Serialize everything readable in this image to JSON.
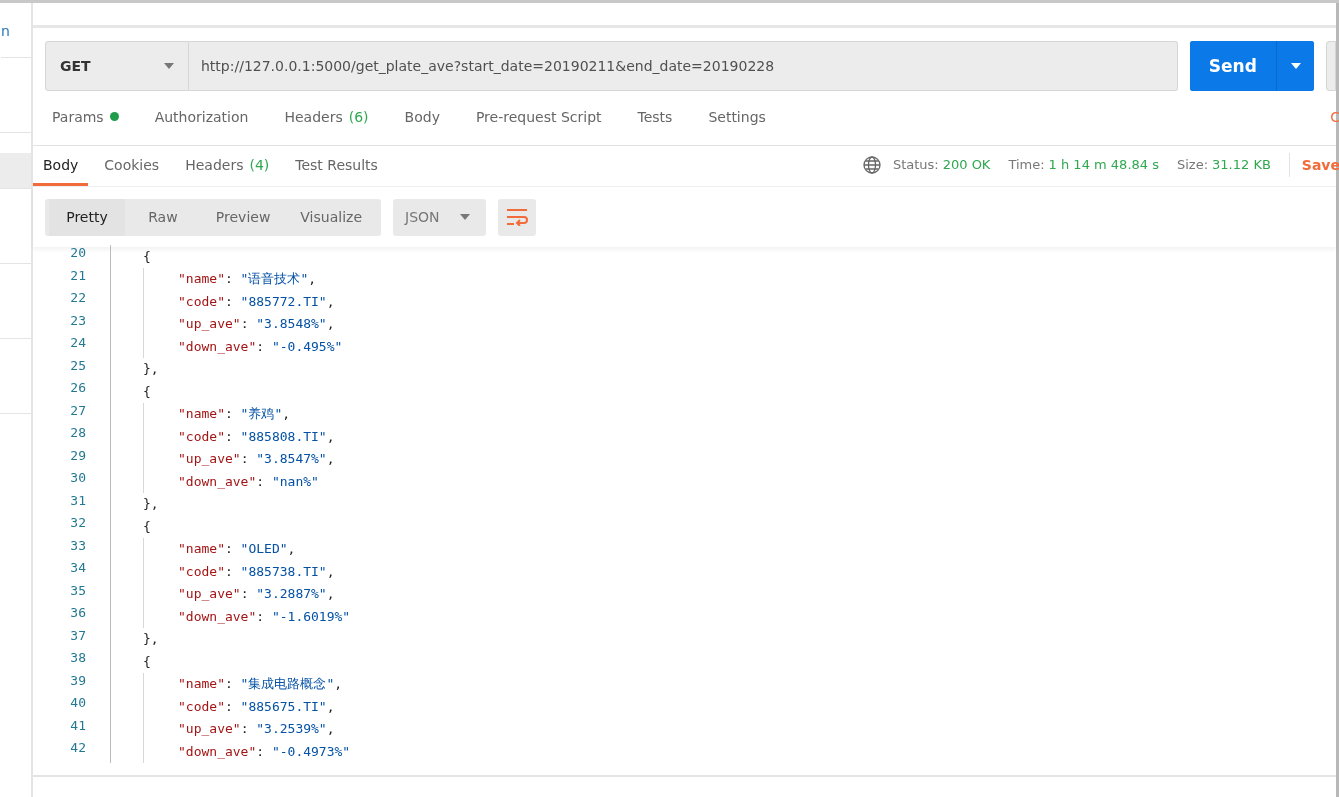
{
  "sidebar": {
    "cut_text": "n",
    "items": [
      {
        "selected": false
      },
      {
        "selected": true
      },
      {
        "selected": false
      },
      {
        "selected": false
      },
      {
        "selected": false
      }
    ]
  },
  "request": {
    "method": "GET",
    "url": "http://127.0.0.1:5000/get_plate_ave?start_date=20190211&end_date=20190228",
    "send": "Send"
  },
  "request_tabs": [
    {
      "label": "Params",
      "dot": true,
      "selected": false
    },
    {
      "label": "Authorization",
      "dot": false,
      "selected": false
    },
    {
      "label": "Headers",
      "count": "(6)",
      "dot": false,
      "selected": false
    },
    {
      "label": "Body",
      "dot": false,
      "selected": false
    },
    {
      "label": "Pre-request Script",
      "dot": false,
      "selected": false
    },
    {
      "label": "Tests",
      "dot": false,
      "selected": false
    },
    {
      "label": "Settings",
      "dot": false,
      "selected": false
    }
  ],
  "request_tabs_cut_link": "C",
  "response_tabs": [
    {
      "label": "Body",
      "selected": true
    },
    {
      "label": "Cookies",
      "selected": false
    },
    {
      "label": "Headers",
      "count": "(4)",
      "selected": false
    },
    {
      "label": "Test Results",
      "selected": false
    }
  ],
  "response_meta": [
    {
      "label": "Status:",
      "value": "200 OK"
    },
    {
      "label": "Time:",
      "value": "1 h 14 m 48.84 s"
    },
    {
      "label": "Size:",
      "value": "31.12 KB"
    }
  ],
  "save": "Save",
  "view_modes": [
    {
      "label": "Pretty",
      "selected": true
    },
    {
      "label": "Raw",
      "selected": false
    },
    {
      "label": "Preview",
      "selected": false
    },
    {
      "label": "Visualize",
      "selected": false
    }
  ],
  "format": "JSON",
  "code_lines": [
    {
      "num": "20",
      "kind": "brace",
      "text": "{"
    },
    {
      "num": "21",
      "kind": "prop",
      "key": "\"name\"",
      "sep": ":",
      "value": "\"语音技术\"",
      "end": ","
    },
    {
      "num": "22",
      "kind": "prop",
      "key": "\"code\"",
      "sep": ":",
      "value": "\"885772.TI\"",
      "end": ","
    },
    {
      "num": "23",
      "kind": "prop",
      "key": "\"up_ave\"",
      "sep": ":",
      "value": "\"3.8548%\"",
      "end": ","
    },
    {
      "num": "24",
      "kind": "prop",
      "key": "\"down_ave\"",
      "sep": ":",
      "value": "\"-0.495%\""
    },
    {
      "num": "25",
      "kind": "brace",
      "text": "},"
    },
    {
      "num": "26",
      "kind": "brace",
      "text": "{"
    },
    {
      "num": "27",
      "kind": "prop",
      "key": "\"name\"",
      "sep": ":",
      "value": "\"养鸡\"",
      "end": ","
    },
    {
      "num": "28",
      "kind": "prop",
      "key": "\"code\"",
      "sep": ":",
      "value": "\"885808.TI\"",
      "end": ","
    },
    {
      "num": "29",
      "kind": "prop",
      "key": "\"up_ave\"",
      "sep": ":",
      "value": "\"3.8547%\"",
      "end": ","
    },
    {
      "num": "30",
      "kind": "prop",
      "key": "\"down_ave\"",
      "sep": ":",
      "value": "\"nan%\""
    },
    {
      "num": "31",
      "kind": "brace",
      "text": "},"
    },
    {
      "num": "32",
      "kind": "brace",
      "text": "{"
    },
    {
      "num": "33",
      "kind": "prop",
      "key": "\"name\"",
      "sep": ":",
      "value": "\"OLED\"",
      "end": ","
    },
    {
      "num": "34",
      "kind": "prop",
      "key": "\"code\"",
      "sep": ":",
      "value": "\"885738.TI\"",
      "end": ","
    },
    {
      "num": "35",
      "kind": "prop",
      "key": "\"up_ave\"",
      "sep": ":",
      "value": "\"3.2887%\"",
      "end": ","
    },
    {
      "num": "36",
      "kind": "prop",
      "key": "\"down_ave\"",
      "sep": ":",
      "value": "\"-1.6019%\""
    },
    {
      "num": "37",
      "kind": "brace",
      "text": "},"
    },
    {
      "num": "38",
      "kind": "brace",
      "text": "{"
    },
    {
      "num": "39",
      "kind": "prop",
      "key": "\"name\"",
      "sep": ":",
      "value": "\"集成电路概念\"",
      "end": ","
    },
    {
      "num": "40",
      "kind": "prop",
      "key": "\"code\"",
      "sep": ":",
      "value": "\"885675.TI\"",
      "end": ","
    },
    {
      "num": "41",
      "kind": "prop",
      "key": "\"up_ave\"",
      "sep": ":",
      "value": "\"3.2539%\"",
      "end": ","
    },
    {
      "num": "42",
      "kind": "prop",
      "key": "\"down_ave\"",
      "sep": ":",
      "value": "\"-0.4973%\""
    }
  ]
}
